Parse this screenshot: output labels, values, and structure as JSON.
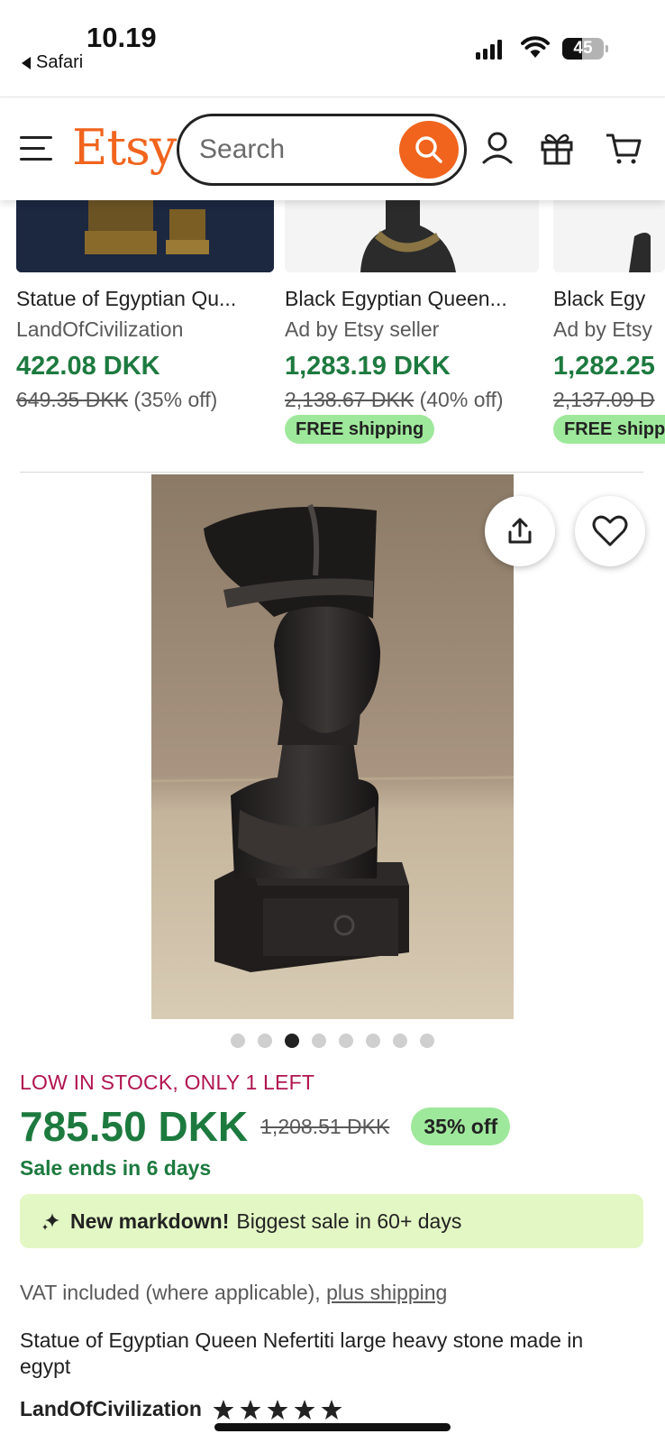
{
  "status_bar": {
    "time": "10.19",
    "back_app": "Safari",
    "battery": "45"
  },
  "header": {
    "logo": "Etsy",
    "search_placeholder": "Search",
    "brand_color": "#f1641e"
  },
  "carousel": [
    {
      "title": "Statue of Egyptian Qu...",
      "subtitle": "LandOfCivilization",
      "price": "422.08 DKK",
      "original_price": "649.35 DKK",
      "discount": "(35% off)",
      "free_shipping": ""
    },
    {
      "title": "Black Egyptian Queen...",
      "subtitle": "Ad by Etsy seller",
      "price": "1,283.19 DKK",
      "original_price": "2,138.67 DKK",
      "discount": "(40% off)",
      "free_shipping": "FREE shipping"
    },
    {
      "title": "Black Egy",
      "subtitle": "Ad by Etsy",
      "price": "1,282.25",
      "original_price": "2,137.09 D",
      "discount": "",
      "free_shipping": "FREE shipp"
    }
  ],
  "gallery": {
    "image_count": 8,
    "active_index": 2
  },
  "product": {
    "stock_notice": "LOW IN STOCK, ONLY 1 LEFT",
    "price": "785.50 DKK",
    "original_price": "1,208.51 DKK",
    "discount_badge": "35% off",
    "sale_ends": "Sale ends in 6 days",
    "markdown_bold": "New markdown!",
    "markdown_text": "Biggest sale in 60+ days",
    "vat_text": "VAT included (where applicable),",
    "vat_link": "plus shipping",
    "title": "Statue of Egyptian Queen Nefertiti large heavy stone made in egypt",
    "shop_name": "LandOfCivilization",
    "rating_stars": 5
  },
  "colors": {
    "price_green": "#1d7a3f",
    "stock_red": "#b1144f",
    "badge_green": "#9ee89b",
    "markdown_bg": "#e3f7c4"
  }
}
